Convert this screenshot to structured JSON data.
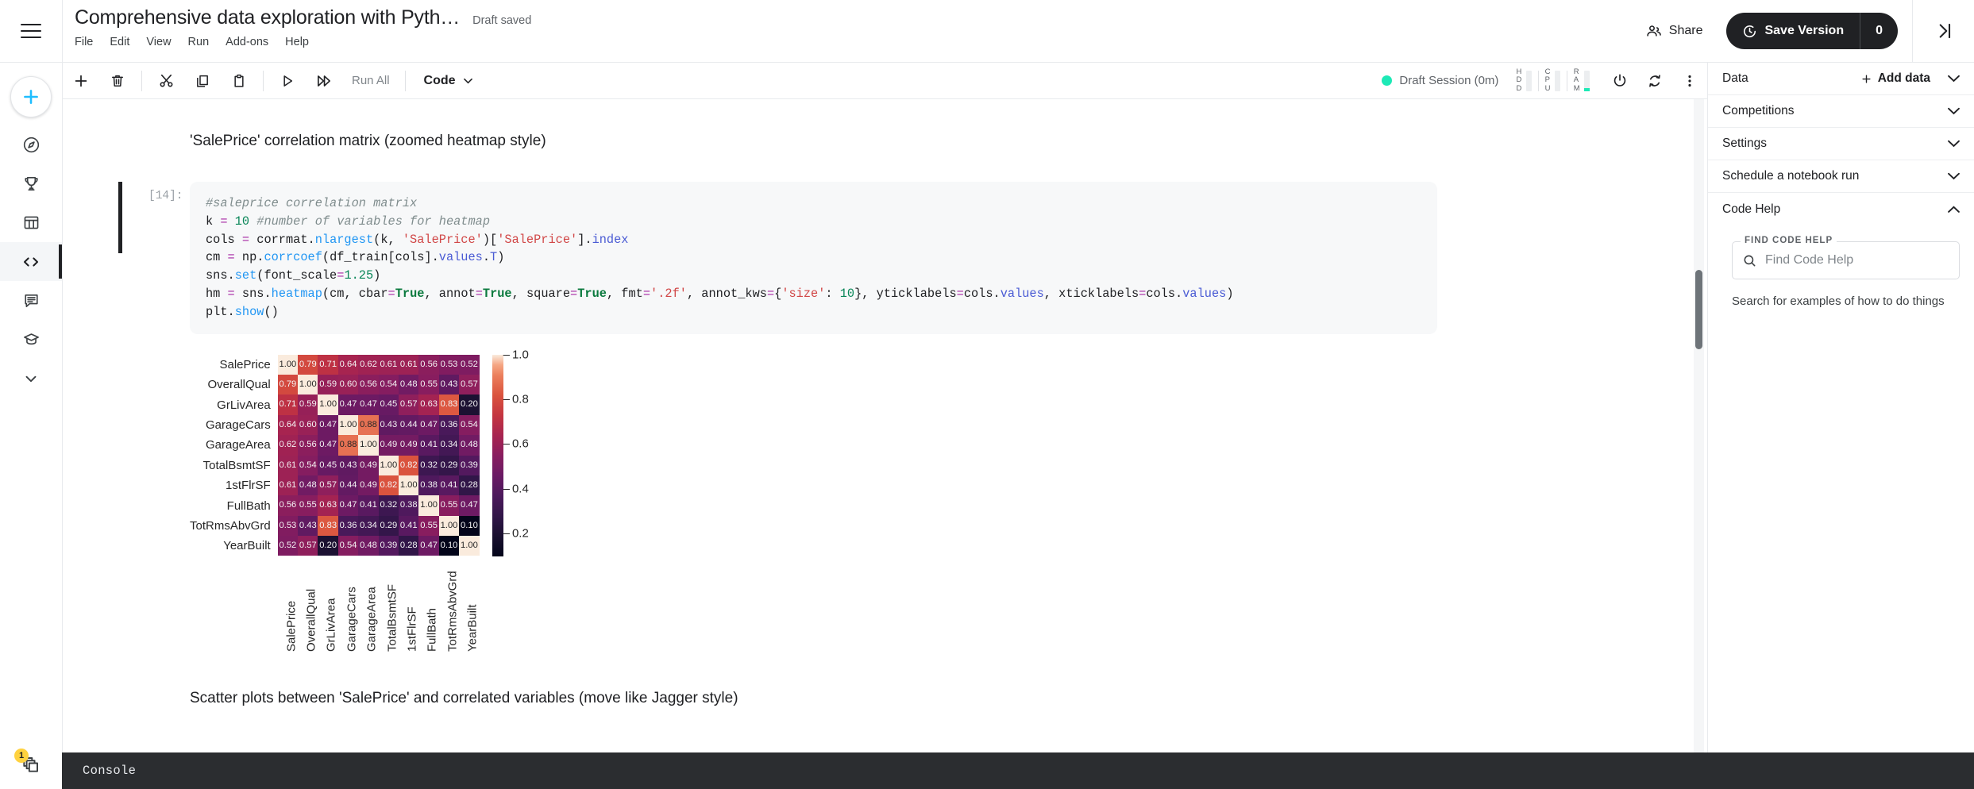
{
  "header": {
    "notebook_title": "Comprehensive data exploration with Pyth…",
    "draft_status": "Draft saved",
    "menus": [
      "File",
      "Edit",
      "View",
      "Run",
      "Add-ons",
      "Help"
    ],
    "share_label": "Share",
    "save_version_label": "Save Version",
    "save_version_count": "0"
  },
  "toolbar": {
    "run_all_label": "Run All",
    "cell_type": "Code",
    "session_status": "Draft Session (0m)",
    "meters": [
      {
        "name": "HDD",
        "letters": [
          "H",
          "D",
          "D"
        ],
        "fill_pct": 0
      },
      {
        "name": "CPU",
        "letters": [
          "C",
          "P",
          "U"
        ],
        "fill_pct": 0
      },
      {
        "name": "RAM",
        "letters": [
          "R",
          "A",
          "M"
        ],
        "fill_pct": 12
      }
    ]
  },
  "rail": {
    "items": [
      {
        "name": "compass-icon",
        "label": "Explore"
      },
      {
        "name": "trophy-icon",
        "label": "Competitions"
      },
      {
        "name": "table-icon",
        "label": "Datasets"
      },
      {
        "name": "code-icon",
        "label": "Code"
      },
      {
        "name": "discussion-icon",
        "label": "Discussions"
      },
      {
        "name": "learn-icon",
        "label": "Learn"
      },
      {
        "name": "chevron-down-icon",
        "label": "More"
      }
    ],
    "badge_count": "1"
  },
  "notebook": {
    "markdown_heading_1": "'SalePrice' correlation matrix (zoomed heatmap style)",
    "markdown_heading_2": "Scatter plots between 'SalePrice' and correlated variables (move like Jagger style)",
    "cell_execution_label": "[14]:",
    "code_lines": [
      "#saleprice correlation matrix",
      "k = 10 #number of variables for heatmap",
      "cols = corrmat.nlargest(k, 'SalePrice')['SalePrice'].index",
      "cm = np.corrcoef(df_train[cols].values.T)",
      "sns.set(font_scale=1.25)",
      "hm = sns.heatmap(cm, cbar=True, annot=True, square=True, fmt='.2f', annot_kws={'size': 10}, yticklabels=cols.values, xticklabels=cols.values)",
      "plt.show()"
    ]
  },
  "right_panel": {
    "sections": [
      {
        "title": "Data",
        "action": "Add data",
        "expanded": false
      },
      {
        "title": "Competitions",
        "expanded": false
      },
      {
        "title": "Settings",
        "expanded": false
      },
      {
        "title": "Schedule a notebook run",
        "expanded": false
      },
      {
        "title": "Code Help",
        "expanded": true
      }
    ],
    "code_help": {
      "legend": "FIND CODE HELP",
      "placeholder": "Find Code Help",
      "value": "",
      "hint": "Search for examples of how to do things"
    }
  },
  "console": {
    "label": "Console"
  },
  "colors": {
    "accent": "#20beff",
    "dark": "#202124",
    "session_dot": "#1de9b6",
    "badge": "#ffd23f",
    "code_bg": "#f7f8f9"
  },
  "chart_data": {
    "type": "heatmap",
    "title": "'SalePrice' correlation matrix (zoomed heatmap style)",
    "colormap": "rocket",
    "annot": true,
    "fmt": ".2f",
    "square": true,
    "cbar": true,
    "cbar_ticks": [
      1.0,
      0.8,
      0.6,
      0.4,
      0.2
    ],
    "vmin": 0.1,
    "vmax": 1.0,
    "categories": [
      "SalePrice",
      "OverallQual",
      "GrLivArea",
      "GarageCars",
      "GarageArea",
      "TotalBsmtSF",
      "1stFlrSF",
      "FullBath",
      "TotRmsAbvGrd",
      "YearBuilt"
    ],
    "xlabel": "",
    "ylabel": "",
    "values": [
      [
        1.0,
        0.79,
        0.71,
        0.64,
        0.62,
        0.61,
        0.61,
        0.56,
        0.53,
        0.52
      ],
      [
        0.79,
        1.0,
        0.59,
        0.6,
        0.56,
        0.54,
        0.48,
        0.55,
        0.43,
        0.57
      ],
      [
        0.71,
        0.59,
        1.0,
        0.47,
        0.47,
        0.45,
        0.57,
        0.63,
        0.83,
        0.2
      ],
      [
        0.64,
        0.6,
        0.47,
        1.0,
        0.88,
        0.43,
        0.44,
        0.47,
        0.36,
        0.54
      ],
      [
        0.62,
        0.56,
        0.47,
        0.88,
        1.0,
        0.49,
        0.49,
        0.41,
        0.34,
        0.48
      ],
      [
        0.61,
        0.54,
        0.45,
        0.43,
        0.49,
        1.0,
        0.82,
        0.32,
        0.29,
        0.39
      ],
      [
        0.61,
        0.48,
        0.57,
        0.44,
        0.49,
        0.82,
        1.0,
        0.38,
        0.41,
        0.28
      ],
      [
        0.56,
        0.55,
        0.63,
        0.47,
        0.41,
        0.32,
        0.38,
        1.0,
        0.55,
        0.47
      ],
      [
        0.53,
        0.43,
        0.83,
        0.36,
        0.34,
        0.29,
        0.41,
        0.55,
        1.0,
        0.1
      ],
      [
        0.52,
        0.57,
        0.2,
        0.54,
        0.48,
        0.39,
        0.28,
        0.47,
        0.1,
        1.0
      ]
    ]
  }
}
